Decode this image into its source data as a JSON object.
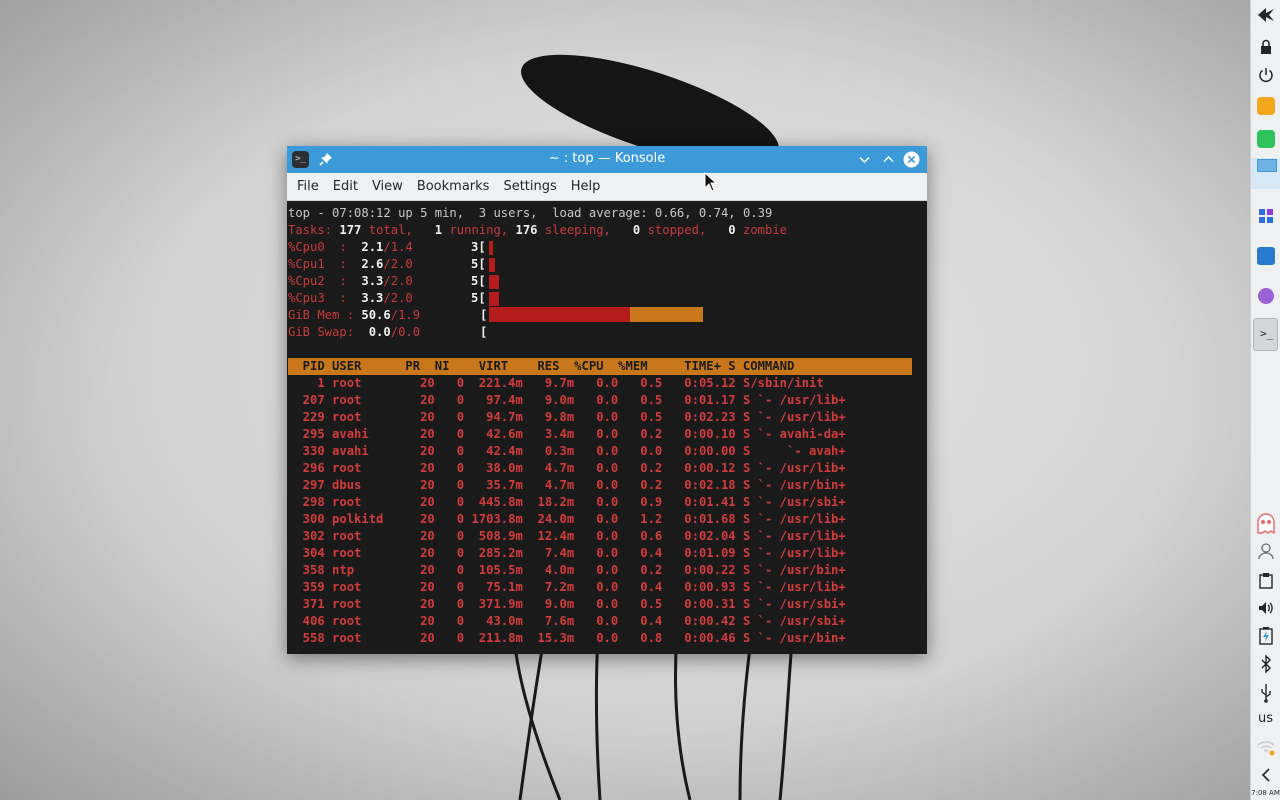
{
  "window": {
    "title": "~ : top — Konsole",
    "app_icon_glyph": ">_",
    "menu": [
      "File",
      "Edit",
      "View",
      "Bookmarks",
      "Settings",
      "Help"
    ]
  },
  "top": {
    "summary": {
      "prefix": "top - ",
      "time": "07:08:12",
      "uptime": " up 5 min,  ",
      "users": "3 users,",
      "load_label": "  load average: ",
      "load": "0.66, 0.74, 0.39"
    },
    "tasks": {
      "label": "Tasks: ",
      "total": "177",
      "total_label": " total,   ",
      "running": "1",
      "running_label": " running, ",
      "sleeping": "176",
      "sleeping_label": " sleeping,   ",
      "stopped": "0",
      "stopped_label": " stopped,   ",
      "zombie": "0",
      "zombie_label": " zombie"
    },
    "cpus": [
      {
        "label": "%Cpu0  :  ",
        "user": "2.1",
        "sys": "/1.4",
        "count": "3",
        "bracket": "["
      },
      {
        "label": "%Cpu1  :  ",
        "user": "2.6",
        "sys": "/2.0",
        "count": "5",
        "bracket": "["
      },
      {
        "label": "%Cpu2  :  ",
        "user": "3.3",
        "sys": "/2.0",
        "count": "5",
        "bracket": "["
      },
      {
        "label": "%Cpu3  :  ",
        "user": "3.3",
        "sys": "/2.0",
        "count": "5",
        "bracket": "["
      }
    ],
    "mem": {
      "label": "GiB Mem : ",
      "value": "50.6",
      "rest": "/1.9",
      "bracket": "[",
      "used_fraction": 0.66,
      "cache_fraction": 0.34
    },
    "swap": {
      "label": "GiB Swap:  ",
      "value": "0.0",
      "rest": "/0.0",
      "bracket": "["
    },
    "columns": "  PID USER      PR  NI    VIRT    RES  %CPU  %MEM     TIME+ S COMMAND",
    "processes": [
      {
        "pid": "1",
        "user": "root",
        "pr": "20",
        "ni": "0",
        "virt": "221.4m",
        "res": "9.7m",
        "cpu": "0.0",
        "mem": "0.5",
        "time": "0:05.12",
        "s": "S",
        "command": "/sbin/init"
      },
      {
        "pid": "207",
        "user": "root",
        "pr": "20",
        "ni": "0",
        "virt": "97.4m",
        "res": "9.0m",
        "cpu": "0.0",
        "mem": "0.5",
        "time": "0:01.17",
        "s": "S",
        "command": " `- /usr/lib+"
      },
      {
        "pid": "229",
        "user": "root",
        "pr": "20",
        "ni": "0",
        "virt": "94.7m",
        "res": "9.8m",
        "cpu": "0.0",
        "mem": "0.5",
        "time": "0:02.23",
        "s": "S",
        "command": " `- /usr/lib+"
      },
      {
        "pid": "295",
        "user": "avahi",
        "pr": "20",
        "ni": "0",
        "virt": "42.6m",
        "res": "3.4m",
        "cpu": "0.0",
        "mem": "0.2",
        "time": "0:00.10",
        "s": "S",
        "command": " `- avahi-da+"
      },
      {
        "pid": "330",
        "user": "avahi",
        "pr": "20",
        "ni": "0",
        "virt": "42.4m",
        "res": "0.3m",
        "cpu": "0.0",
        "mem": "0.0",
        "time": "0:00.00",
        "s": "S",
        "command": "     `- avah+"
      },
      {
        "pid": "296",
        "user": "root",
        "pr": "20",
        "ni": "0",
        "virt": "38.0m",
        "res": "4.7m",
        "cpu": "0.0",
        "mem": "0.2",
        "time": "0:00.12",
        "s": "S",
        "command": " `- /usr/lib+"
      },
      {
        "pid": "297",
        "user": "dbus",
        "pr": "20",
        "ni": "0",
        "virt": "35.7m",
        "res": "4.7m",
        "cpu": "0.0",
        "mem": "0.2",
        "time": "0:02.18",
        "s": "S",
        "command": " `- /usr/bin+"
      },
      {
        "pid": "298",
        "user": "root",
        "pr": "20",
        "ni": "0",
        "virt": "445.8m",
        "res": "18.2m",
        "cpu": "0.0",
        "mem": "0.9",
        "time": "0:01.41",
        "s": "S",
        "command": " `- /usr/sbi+"
      },
      {
        "pid": "300",
        "user": "polkitd",
        "pr": "20",
        "ni": "0",
        "virt": "1703.8m",
        "res": "24.0m",
        "cpu": "0.0",
        "mem": "1.2",
        "time": "0:01.68",
        "s": "S",
        "command": " `- /usr/lib+"
      },
      {
        "pid": "302",
        "user": "root",
        "pr": "20",
        "ni": "0",
        "virt": "508.9m",
        "res": "12.4m",
        "cpu": "0.0",
        "mem": "0.6",
        "time": "0:02.04",
        "s": "S",
        "command": " `- /usr/lib+"
      },
      {
        "pid": "304",
        "user": "root",
        "pr": "20",
        "ni": "0",
        "virt": "285.2m",
        "res": "7.4m",
        "cpu": "0.0",
        "mem": "0.4",
        "time": "0:01.09",
        "s": "S",
        "command": " `- /usr/lib+"
      },
      {
        "pid": "358",
        "user": "ntp",
        "pr": "20",
        "ni": "0",
        "virt": "105.5m",
        "res": "4.0m",
        "cpu": "0.0",
        "mem": "0.2",
        "time": "0:00.22",
        "s": "S",
        "command": " `- /usr/bin+"
      },
      {
        "pid": "359",
        "user": "root",
        "pr": "20",
        "ni": "0",
        "virt": "75.1m",
        "res": "7.2m",
        "cpu": "0.0",
        "mem": "0.4",
        "time": "0:00.93",
        "s": "S",
        "command": " `- /usr/lib+"
      },
      {
        "pid": "371",
        "user": "root",
        "pr": "20",
        "ni": "0",
        "virt": "371.9m",
        "res": "9.0m",
        "cpu": "0.0",
        "mem": "0.5",
        "time": "0:00.31",
        "s": "S",
        "command": " `- /usr/sbi+"
      },
      {
        "pid": "406",
        "user": "root",
        "pr": "20",
        "ni": "0",
        "virt": "43.0m",
        "res": "7.6m",
        "cpu": "0.0",
        "mem": "0.4",
        "time": "0:00.42",
        "s": "S",
        "command": " `- /usr/sbi+"
      },
      {
        "pid": "558",
        "user": "root",
        "pr": "20",
        "ni": "0",
        "virt": "211.8m",
        "res": "15.3m",
        "cpu": "0.0",
        "mem": "0.8",
        "time": "0:00.46",
        "s": "S",
        "command": " `- /usr/bin+"
      }
    ]
  },
  "panel": {
    "keyboard_layout": "us",
    "clock": "7:08 AM",
    "icons": [
      "kde-menu-icon",
      "lock-icon",
      "power-icon",
      "notes-icon",
      "calculator-icon",
      "window-icon",
      "apps-grid-icon",
      "file-manager-icon",
      "discover-icon",
      "konsole-icon",
      "ghost-icon",
      "user-icon",
      "clipboard-icon",
      "volume-icon",
      "battery-icon",
      "bluetooth-icon",
      "usb-icon",
      "wifi-icon",
      "collapse-icon"
    ]
  },
  "colors": {
    "titlebar": "#3d9ad8",
    "header": "#c8781a",
    "proc_text": "#c73b3b",
    "mem_used": "#b51c1c",
    "mem_cache": "#c8781a"
  }
}
